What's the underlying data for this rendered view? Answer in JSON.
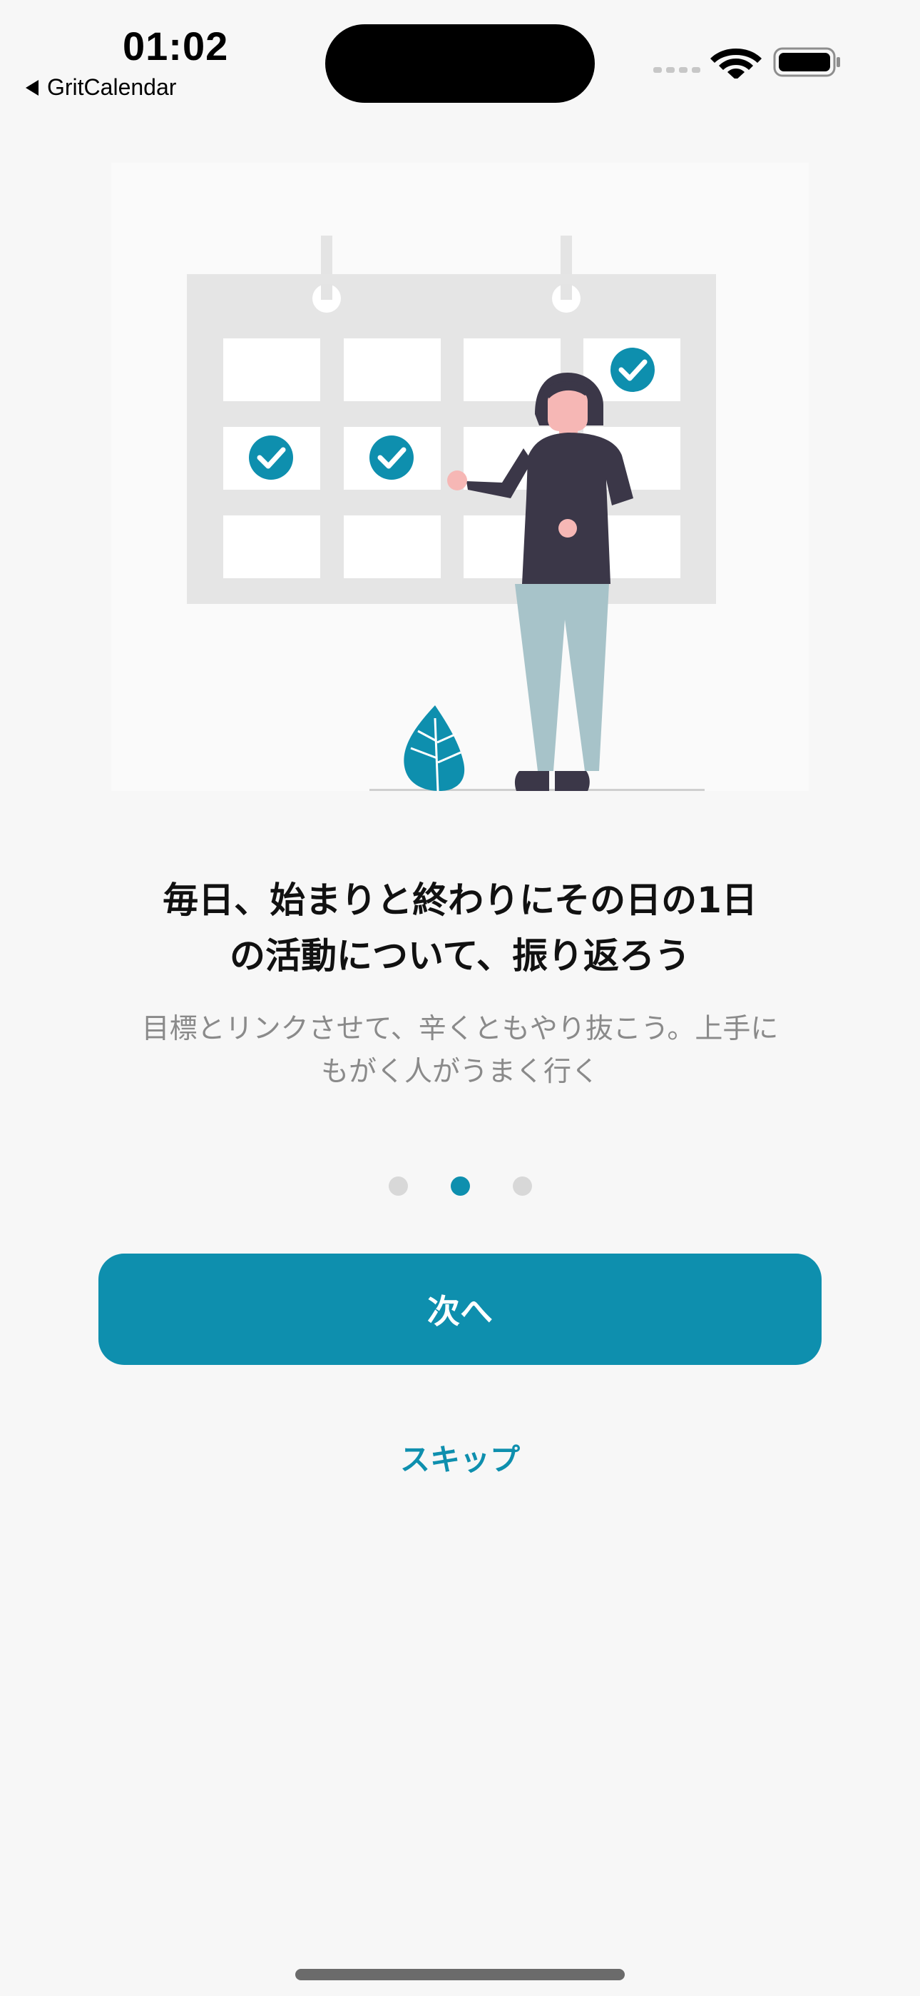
{
  "status_bar": {
    "time": "01:02",
    "back_app_label": "GritCalendar",
    "signal_icon": "cellular-dots-icon",
    "wifi_icon": "wifi-icon",
    "battery_icon": "battery-icon"
  },
  "illustration": {
    "icon": "calendar-person-illustration"
  },
  "onboarding": {
    "title_line1": "毎日、始まりと終わりにその日の1日",
    "title_line2": "の活動について、振り返ろう",
    "subtitle_line1": "目標とリンクさせて、辛くともやり抜こう。上手に",
    "subtitle_line2": "もがく人がうまく行く",
    "page_count": 3,
    "current_page": 2
  },
  "buttons": {
    "next_label": "次へ",
    "skip_label": "スキップ"
  },
  "colors": {
    "accent": "#0e8fae",
    "background": "#f7f7f7",
    "dot_inactive": "#d8d8d8"
  }
}
